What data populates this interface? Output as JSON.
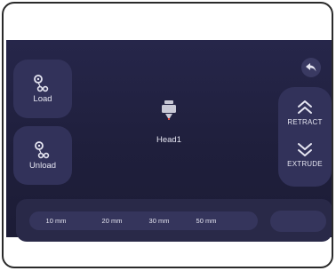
{
  "filament": {
    "load_label": "Load",
    "unload_label": "Unload"
  },
  "head": {
    "label": "Head1"
  },
  "motion": {
    "retract_label": "RETRACT",
    "extrude_label": "EXTRUDE"
  },
  "distances": {
    "options": [
      "10 mm",
      "20 mm",
      "30 mm",
      "50 mm"
    ]
  },
  "colors": {
    "background": "#1f1f3c",
    "button": "#32325a",
    "nozzle_tip": "#e0443c"
  },
  "icons": [
    "spool-icon",
    "back-arrow-icon",
    "print-head-icon",
    "chevron-up-double-icon",
    "chevron-down-double-icon"
  ]
}
